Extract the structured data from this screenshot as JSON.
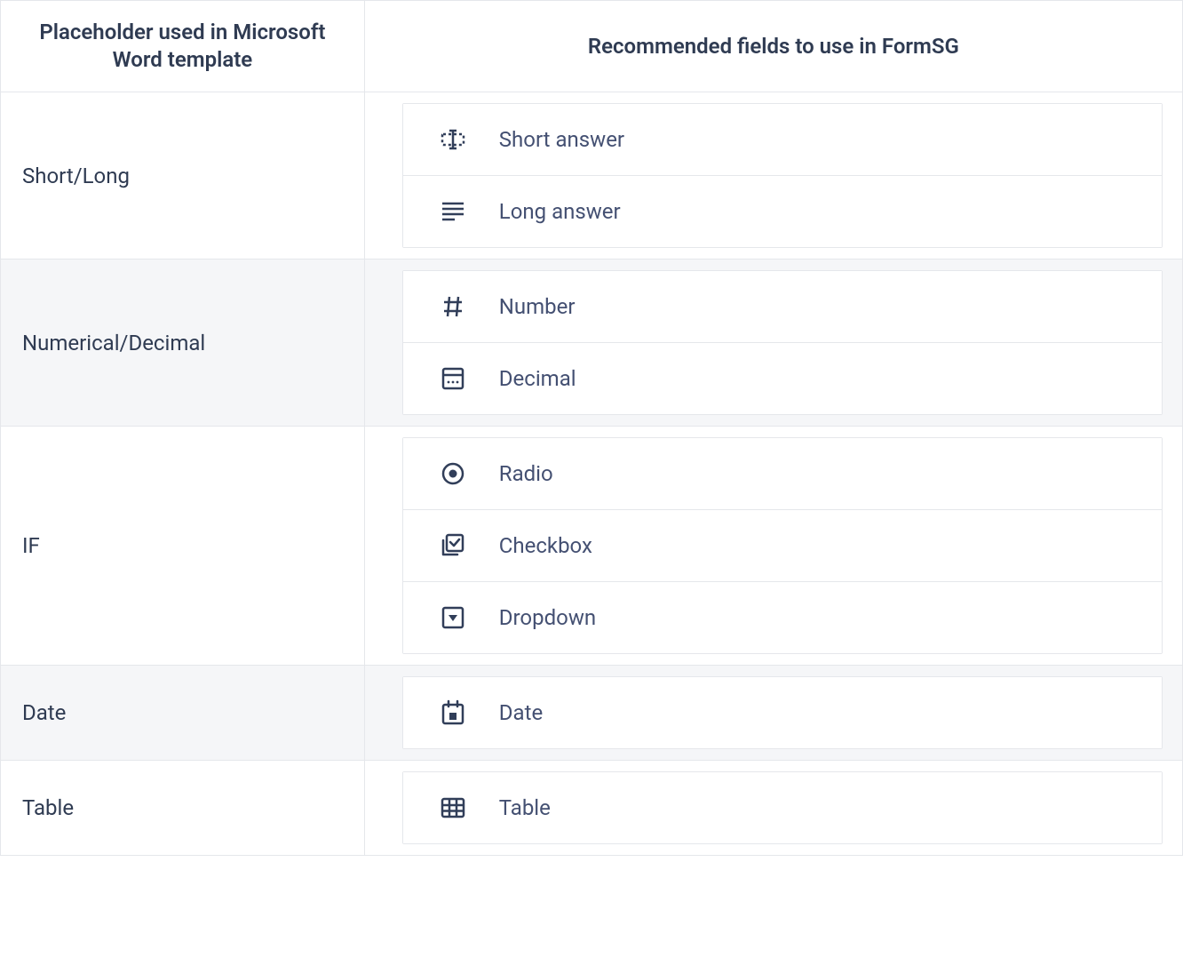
{
  "headers": {
    "placeholder": "Placeholder used in Microsoft Word template",
    "fields": "Recommended fields to use in FormSG"
  },
  "rows": [
    {
      "placeholder": "Short/Long",
      "alt": false,
      "fields": [
        {
          "icon": "short-answer-icon",
          "label": "Short answer"
        },
        {
          "icon": "long-answer-icon",
          "label": "Long answer"
        }
      ]
    },
    {
      "placeholder": "Numerical/Decimal",
      "alt": true,
      "fields": [
        {
          "icon": "number-icon",
          "label": "Number"
        },
        {
          "icon": "decimal-icon",
          "label": "Decimal"
        }
      ]
    },
    {
      "placeholder": "IF",
      "alt": false,
      "fields": [
        {
          "icon": "radio-icon",
          "label": "Radio"
        },
        {
          "icon": "checkbox-icon",
          "label": "Checkbox"
        },
        {
          "icon": "dropdown-icon",
          "label": "Dropdown"
        }
      ]
    },
    {
      "placeholder": "Date",
      "alt": true,
      "fields": [
        {
          "icon": "date-icon",
          "label": "Date"
        }
      ]
    },
    {
      "placeholder": "Table",
      "alt": false,
      "fields": [
        {
          "icon": "table-icon",
          "label": "Table"
        }
      ]
    }
  ]
}
